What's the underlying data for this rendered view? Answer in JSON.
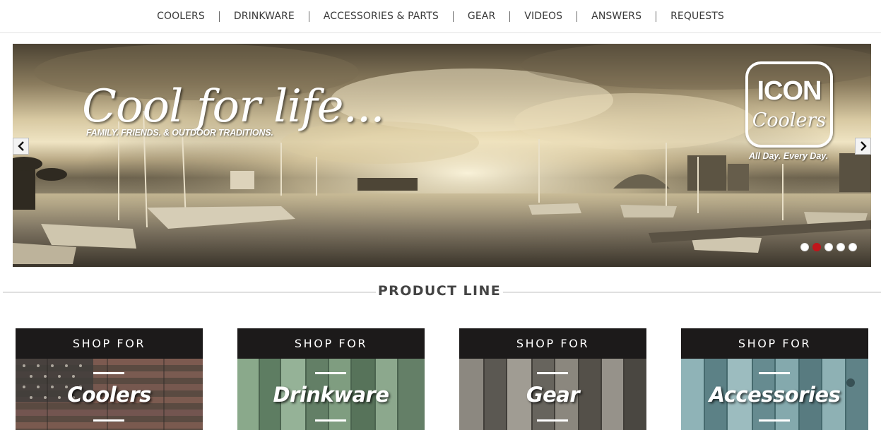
{
  "nav": {
    "items": [
      {
        "label": "COOLERS"
      },
      {
        "label": "DRINKWARE"
      },
      {
        "label": "ACCESSORIES & PARTS"
      },
      {
        "label": "GEAR"
      },
      {
        "label": "VIDEOS"
      },
      {
        "label": "ANSWERS"
      },
      {
        "label": "REQUESTS"
      }
    ]
  },
  "hero": {
    "headline": "Cool for life...",
    "subline": "FAMILY. FRIENDS. & OUTDOOR TRADITIONS.",
    "logo_top": "ICON",
    "logo_bottom": "Coolers",
    "logo_tagline": "All Day. Every Day.",
    "slide_count": 5,
    "active_slide": 2,
    "prev_icon": "chevron-left-icon",
    "next_icon": "chevron-right-icon"
  },
  "product_line": {
    "title": "PRODUCT LINE"
  },
  "cards": [
    {
      "heading": "SHOP FOR",
      "label": "Coolers"
    },
    {
      "heading": "SHOP FOR",
      "label": "Drinkware"
    },
    {
      "heading": "SHOP FOR",
      "label": "Gear"
    },
    {
      "heading": "SHOP FOR",
      "label": "Accessories"
    }
  ],
  "colors": {
    "active_dot": "#c0151b",
    "card_header": "#1c1a1a",
    "drinkware_wood": "#6f8f73",
    "gear_wood": "#6e6b64",
    "accessories_wood": "#6f969b"
  }
}
